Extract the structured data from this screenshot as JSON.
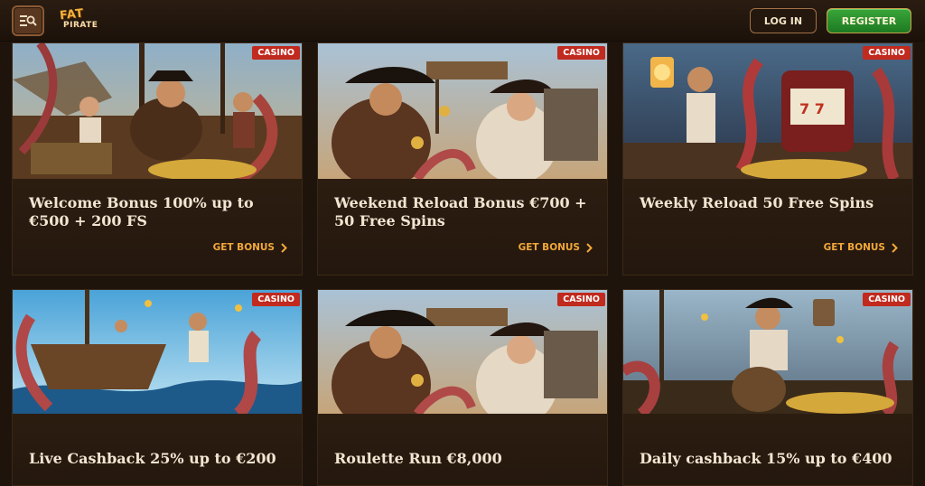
{
  "header": {
    "menu_icon": "menu-search-icon",
    "logo_line1": "FAT",
    "logo_line2": "PIRATE",
    "login_label": "LOG IN",
    "register_label": "REGISTER"
  },
  "colors": {
    "background": "#1f140c",
    "card": "#2a1c11",
    "badge": "#c12a1e",
    "cta": "#f2a83a",
    "register": "#1d7a22"
  },
  "cards": [
    {
      "badge": "CASINO",
      "title": "Welcome Bonus 100% up to €500 + 200 FS",
      "cta": "GET BONUS",
      "cta_icon": "chevron-right-icon"
    },
    {
      "badge": "CASINO",
      "title": "Weekend Reload Bonus €700 + 50 Free Spins",
      "cta": "GET BONUS",
      "cta_icon": "chevron-right-icon"
    },
    {
      "badge": "CASINO",
      "title": "Weekly Reload 50 Free Spins",
      "cta": "GET BONUS",
      "cta_icon": "chevron-right-icon"
    },
    {
      "badge": "CASINO",
      "title": "Live Cashback 25% up to €200",
      "cta": "",
      "cta_icon": ""
    },
    {
      "badge": "CASINO",
      "title": "Roulette Run €8,000",
      "cta": "",
      "cta_icon": ""
    },
    {
      "badge": "CASINO",
      "title": "Daily cashback 15% up to €400",
      "cta": "",
      "cta_icon": ""
    }
  ]
}
